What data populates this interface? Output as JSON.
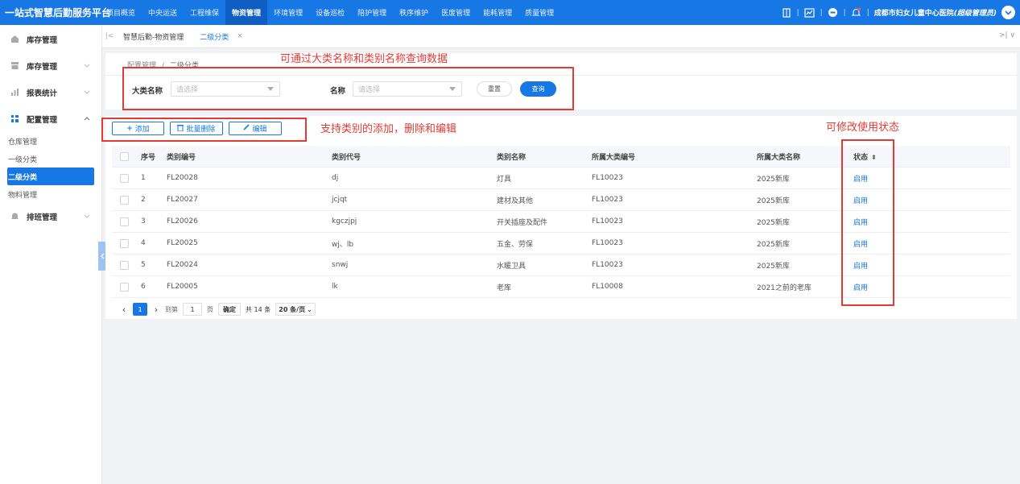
{
  "app": {
    "brand": "一站式智慧后勤服务平台"
  },
  "topnav": {
    "items": [
      {
        "label": "项目概览",
        "active": false
      },
      {
        "label": "中央运送",
        "active": false
      },
      {
        "label": "工程维保",
        "active": false
      },
      {
        "label": "物资管理",
        "active": true
      },
      {
        "label": "环境管理",
        "active": false
      },
      {
        "label": "设备巡检",
        "active": false
      },
      {
        "label": "陪护管理",
        "active": false
      },
      {
        "label": "秩序维护",
        "active": false
      },
      {
        "label": "医废管理",
        "active": false
      },
      {
        "label": "能耗管理",
        "active": false
      },
      {
        "label": "质量管理",
        "active": false
      }
    ],
    "user_org": "成都市妇女儿童中心医院",
    "user_role": "(超级管理员)"
  },
  "sidebar": {
    "items": [
      {
        "label": "库存管理",
        "icon": "home-icon"
      },
      {
        "label": "库存管理",
        "icon": "box-icon"
      },
      {
        "label": "报表统计",
        "icon": "chart-icon"
      },
      {
        "label": "配置管理",
        "icon": "grid-icon"
      },
      {
        "label": "排班管理",
        "icon": "bell-icon"
      }
    ],
    "subitems": [
      {
        "label": "仓库管理"
      },
      {
        "label": "一级分类"
      },
      {
        "label": "二级分类",
        "active": true
      },
      {
        "label": "物料管理"
      }
    ]
  },
  "tabs": [
    {
      "label": "智慧后勤-物资管理"
    },
    {
      "label": "二级分类",
      "active": true
    }
  ],
  "search": {
    "breadcrumb_parent": "配置管理",
    "breadcrumb_sep": "/",
    "breadcrumb_current": "二级分类",
    "category_label": "大类名称",
    "category_placeholder": "请选择",
    "name_label": "名称",
    "name_placeholder": "请选择",
    "reset_label": "重置",
    "query_label": "查询"
  },
  "toolbar": {
    "add_label": "添加",
    "batch_delete_label": "批量删除",
    "edit_label": "编辑"
  },
  "table": {
    "headers": {
      "no": "序号",
      "code": "类别编号",
      "dh": "类别代号",
      "name": "类别名称",
      "pcode": "所属大类编号",
      "pname": "所属大类名称",
      "status": "状态"
    },
    "rows": [
      {
        "no": "1",
        "code": "FL20028",
        "dh": "dj",
        "name": "灯具",
        "pcode": "FL10023",
        "pname": "2025新库",
        "status": "启用"
      },
      {
        "no": "2",
        "code": "FL20027",
        "dh": "jcjqt",
        "name": "建材及其他",
        "pcode": "FL10023",
        "pname": "2025新库",
        "status": "启用"
      },
      {
        "no": "3",
        "code": "FL20026",
        "dh": "kgczjpj",
        "name": "开关插座及配件",
        "pcode": "FL10023",
        "pname": "2025新库",
        "status": "启用"
      },
      {
        "no": "4",
        "code": "FL20025",
        "dh": "wj、lb",
        "name": "五金、劳保",
        "pcode": "FL10023",
        "pname": "2025新库",
        "status": "启用"
      },
      {
        "no": "5",
        "code": "FL20024",
        "dh": "snwj",
        "name": "水暖卫具",
        "pcode": "FL10023",
        "pname": "2025新库",
        "status": "启用"
      },
      {
        "no": "6",
        "code": "FL20005",
        "dh": "lk",
        "name": "老库",
        "pcode": "FL10008",
        "pname": "2021之前的老库",
        "status": "启用"
      }
    ]
  },
  "pager": {
    "current_page": "1",
    "goto_label": "到第",
    "goto_value": "1",
    "page_unit": "页",
    "confirm_label": "确定",
    "total_label": "共 14 条",
    "size_label": "20 条/页"
  },
  "annotations": {
    "search_note": "可通过大类名称和类别名称查询数据",
    "toolbar_note": "支持类别的添加，删除和编辑",
    "status_note": "可修改使用状态"
  }
}
